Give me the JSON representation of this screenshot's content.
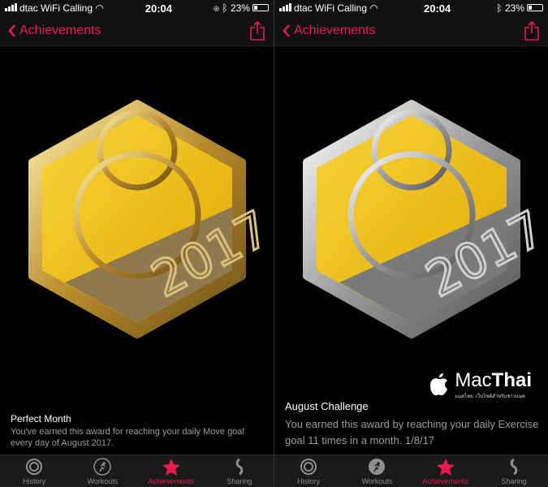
{
  "status": {
    "carrier": "dtac WiFi Calling",
    "time": "20:04",
    "battery": "23%"
  },
  "nav": {
    "back_label": "Achievements"
  },
  "tabs": [
    "History",
    "Workouts",
    "Achievements",
    "Sharing"
  ],
  "colors": {
    "accent": "#e8194f",
    "gold": "#f2c01e",
    "silver": "#c8c8c8"
  },
  "screens": [
    {
      "title": "Perfect Month",
      "description": "You've earned this award for reaching your daily Move goal every day of August 2017."
    },
    {
      "title": "August Challenge",
      "description": "You earned this award by reaching your daily Exercise goal 11 times in a month. 1/8/17"
    }
  ],
  "watermark": {
    "brand_a": "Mac",
    "brand_b": "Thai",
    "tagline": "แมคไทย: เว็บไซต์สำหรับชาวแมค"
  },
  "medal_text": "2017"
}
